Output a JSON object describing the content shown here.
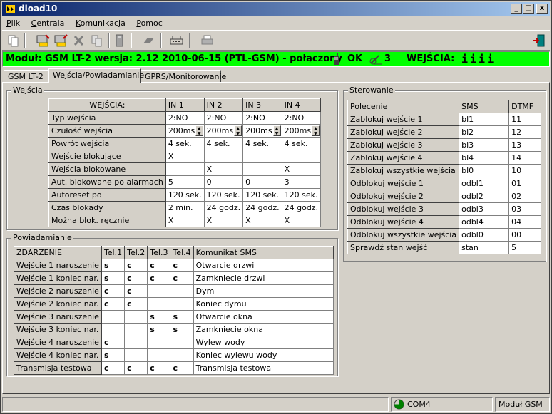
{
  "window": {
    "title": "dload10",
    "btn_min": "_",
    "btn_max": "□",
    "btn_close": "x"
  },
  "menu": [
    {
      "u": "P",
      "rest": "lik"
    },
    {
      "u": "C",
      "rest": "entrala"
    },
    {
      "u": "K",
      "rest": "omunikacja"
    },
    {
      "u": "P",
      "rest": "omoc"
    }
  ],
  "status": {
    "module": "Moduł: GSM LT-2 wersja: 2.12 2010-06-15 (PTL-GSM) -  połączony",
    "ok": "OK",
    "signal": "3",
    "inputs_label": "WEJŚCIA:",
    "inputs_value": "iiii"
  },
  "tabs": [
    "GSM LT-2",
    "Wejścia/Powiadamianie",
    "GPRS/Monitorowanie"
  ],
  "wejscia": {
    "title": "Wejścia",
    "header": [
      "WEJŚCIA:",
      "IN 1",
      "IN 2",
      "IN 3",
      "IN 4"
    ],
    "rows": [
      {
        "label": "Typ wejścia",
        "vals": [
          "2:NO",
          "2:NO",
          "2:NO",
          "2:NO"
        ]
      },
      {
        "label": "Czułość wejścia",
        "vals": [
          "200ms",
          "200ms",
          "200ms",
          "200ms"
        ]
      },
      {
        "label": "Powrót wejścia",
        "vals": [
          "4 sek.",
          "4 sek.",
          "4 sek.",
          "4 sek."
        ]
      },
      {
        "label": "Wejście blokujące",
        "vals": [
          "X",
          "",
          "",
          ""
        ]
      },
      {
        "label": "Wejścia blokowane",
        "vals": [
          "",
          "X",
          "",
          "X"
        ]
      },
      {
        "label": "Aut. blokowane po alarmach",
        "vals": [
          "5",
          "0",
          "0",
          "3"
        ]
      },
      {
        "label": "Autoreset po",
        "vals": [
          "120 sek.",
          "120 sek.",
          "120 sek.",
          "120 sek."
        ]
      },
      {
        "label": "Czas blokady",
        "vals": [
          "2 min.",
          "24 godz.",
          "24 godz.",
          "24 godz."
        ]
      },
      {
        "label": "Można blok. ręcznie",
        "vals": [
          "X",
          "X",
          "X",
          "X"
        ]
      }
    ]
  },
  "powiadamianie": {
    "title": "Powiadamianie",
    "header": [
      "ZDARZENIE",
      "Tel.1",
      "Tel.2",
      "Tel.3",
      "Tel.4",
      "Komunikat SMS"
    ],
    "rows": [
      {
        "event": "Wejście 1 naruszenie",
        "t": [
          "s",
          "c",
          "c",
          "c"
        ],
        "sms": "Otwarcie drzwi"
      },
      {
        "event": "Wejście 1 koniec nar.",
        "t": [
          "s",
          "c",
          "c",
          "c"
        ],
        "sms": "Zamkniecie drzwi"
      },
      {
        "event": "Wejście 2 naruszenie",
        "t": [
          "c",
          "c",
          "",
          ""
        ],
        "sms": "Dym"
      },
      {
        "event": "Wejście 2 koniec nar.",
        "t": [
          "c",
          "c",
          "",
          ""
        ],
        "sms": "Koniec dymu"
      },
      {
        "event": "Wejście 3 naruszenie",
        "t": [
          "",
          "",
          "s",
          "s"
        ],
        "sms": "Otwarcie okna"
      },
      {
        "event": "Wejście 3 koniec nar.",
        "t": [
          "",
          "",
          "s",
          "s"
        ],
        "sms": "Zamkniecie okna"
      },
      {
        "event": "Wejście 4 naruszenie",
        "t": [
          "c",
          "",
          "",
          ""
        ],
        "sms": "Wylew wody"
      },
      {
        "event": "Wejście 4 koniec nar.",
        "t": [
          "s",
          "",
          "",
          ""
        ],
        "sms": "Koniec wylewu wody"
      },
      {
        "event": "Transmisja testowa",
        "t": [
          "c",
          "c",
          "c",
          "c"
        ],
        "sms": "Transmisja testowa"
      }
    ]
  },
  "sterowanie": {
    "title": "Sterowanie",
    "header": [
      "Polecenie",
      "SMS",
      "DTMF"
    ],
    "rows": [
      [
        "Zablokuj wejście 1",
        "bl1",
        "11"
      ],
      [
        "Zablokuj wejście 2",
        "bl2",
        "12"
      ],
      [
        "Zablokuj wejście 3",
        "bl3",
        "13"
      ],
      [
        "Zablokuj wejście 4",
        "bl4",
        "14"
      ],
      [
        "Zablokuj wszystkie wejścia",
        "bl0",
        "10"
      ],
      [
        "Odblokuj wejście 1",
        "odbl1",
        "01"
      ],
      [
        "Odblokuj wejście 2",
        "odbl2",
        "02"
      ],
      [
        "Odblokuj wejście 3",
        "odbl3",
        "03"
      ],
      [
        "Odblokuj wejście 4",
        "odbl4",
        "04"
      ],
      [
        "Odblokuj wszystkie wejścia",
        "odbl0",
        "00"
      ],
      [
        "Sprawdź stan wejść",
        "stan",
        "5"
      ]
    ]
  },
  "statusbar": {
    "port": "COM4",
    "device": "Moduł GSM"
  },
  "colors": {
    "status_bg": "#00ff00",
    "title_start": "#0a246a",
    "title_end": "#a6caf0"
  },
  "icons": [
    "documents-icon",
    "read-icon",
    "write-icon",
    "delete-icon",
    "copy-icon",
    "calculator-icon",
    "eraser-icon",
    "modem-icon",
    "printer-icon",
    "exit-icon",
    "phone-icon",
    "satellite-icon",
    "connection-icon"
  ]
}
